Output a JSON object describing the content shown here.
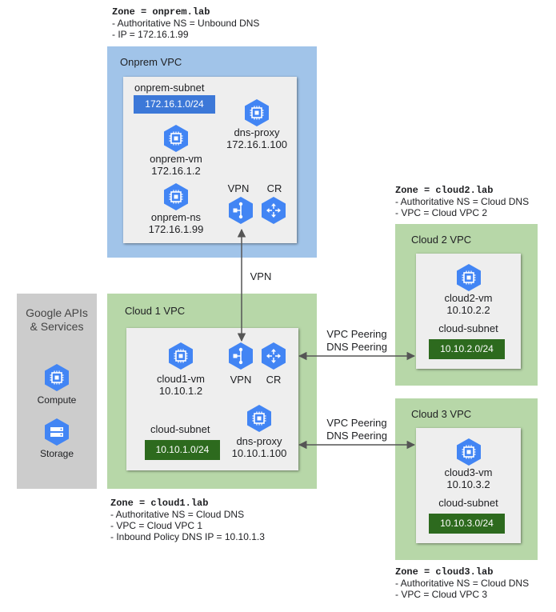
{
  "zones": {
    "onprem": {
      "title": "Zone = onprem.lab",
      "lines": [
        "- Authoritative NS = Unbound DNS",
        "- IP = 172.16.1.99"
      ]
    },
    "cloud1": {
      "title": "Zone = cloud1.lab",
      "lines": [
        "- Authoritative NS = Cloud DNS",
        "- VPC = Cloud VPC 1",
        "- Inbound Policy DNS IP = 10.10.1.3"
      ]
    },
    "cloud2": {
      "title": "Zone = cloud2.lab",
      "lines": [
        "- Authoritative NS = Cloud DNS",
        "- VPC = Cloud VPC 2"
      ]
    },
    "cloud3": {
      "title": "Zone = cloud3.lab",
      "lines": [
        "- Authoritative NS = Cloud DNS",
        "- VPC = Cloud VPC 3"
      ]
    }
  },
  "google_apis": {
    "title_line1": "Google APIs",
    "title_line2": "& Services",
    "compute_label": "Compute",
    "storage_label": "Storage"
  },
  "onprem_vpc": {
    "title": "Onprem VPC",
    "subnet_name": "onprem-subnet",
    "subnet_cidr": "172.16.1.0/24",
    "vm_name": "onprem-vm",
    "vm_ip": "172.16.1.2",
    "ns_name": "onprem-ns",
    "ns_ip": "172.16.1.99",
    "proxy_name": "dns-proxy",
    "proxy_ip": "172.16.1.100",
    "vpn_label": "VPN",
    "cr_label": "CR"
  },
  "cloud1_vpc": {
    "title": "Cloud 1 VPC",
    "vm_name": "cloud1-vm",
    "vm_ip": "10.10.1.2",
    "vpn_label": "VPN",
    "cr_label": "CR",
    "subnet_name": "cloud-subnet",
    "subnet_cidr": "10.10.1.0/24",
    "proxy_name": "dns-proxy",
    "proxy_ip": "10.10.1.100"
  },
  "cloud2_vpc": {
    "title": "Cloud 2 VPC",
    "vm_name": "cloud2-vm",
    "vm_ip": "10.10.2.2",
    "subnet_name": "cloud-subnet",
    "subnet_cidr": "10.10.2.0/24"
  },
  "cloud3_vpc": {
    "title": "Cloud 3 VPC",
    "vm_name": "cloud3-vm",
    "vm_ip": "10.10.3.2",
    "subnet_name": "cloud-subnet",
    "subnet_cidr": "10.10.3.0/24"
  },
  "links": {
    "vpn_label": "VPN",
    "peering2_line1": "VPC Peering",
    "peering2_line2": "DNS Peering",
    "peering3_line1": "VPC Peering",
    "peering3_line2": "DNS Peering"
  },
  "colors": {
    "onprem_bg": "#a1c4e9",
    "cloud_bg": "#b7d7a8",
    "api_bg": "#cccccc",
    "inner_bg": "#eeeeee",
    "blue_subnet": "#3c78d8",
    "green_subnet": "#2d6a1e",
    "icon_blue": "#4285f4"
  },
  "icons": {
    "vm": "compute-engine-icon",
    "storage": "cloud-storage-icon",
    "vpn": "cloud-vpn-icon",
    "router": "cloud-router-icon"
  }
}
